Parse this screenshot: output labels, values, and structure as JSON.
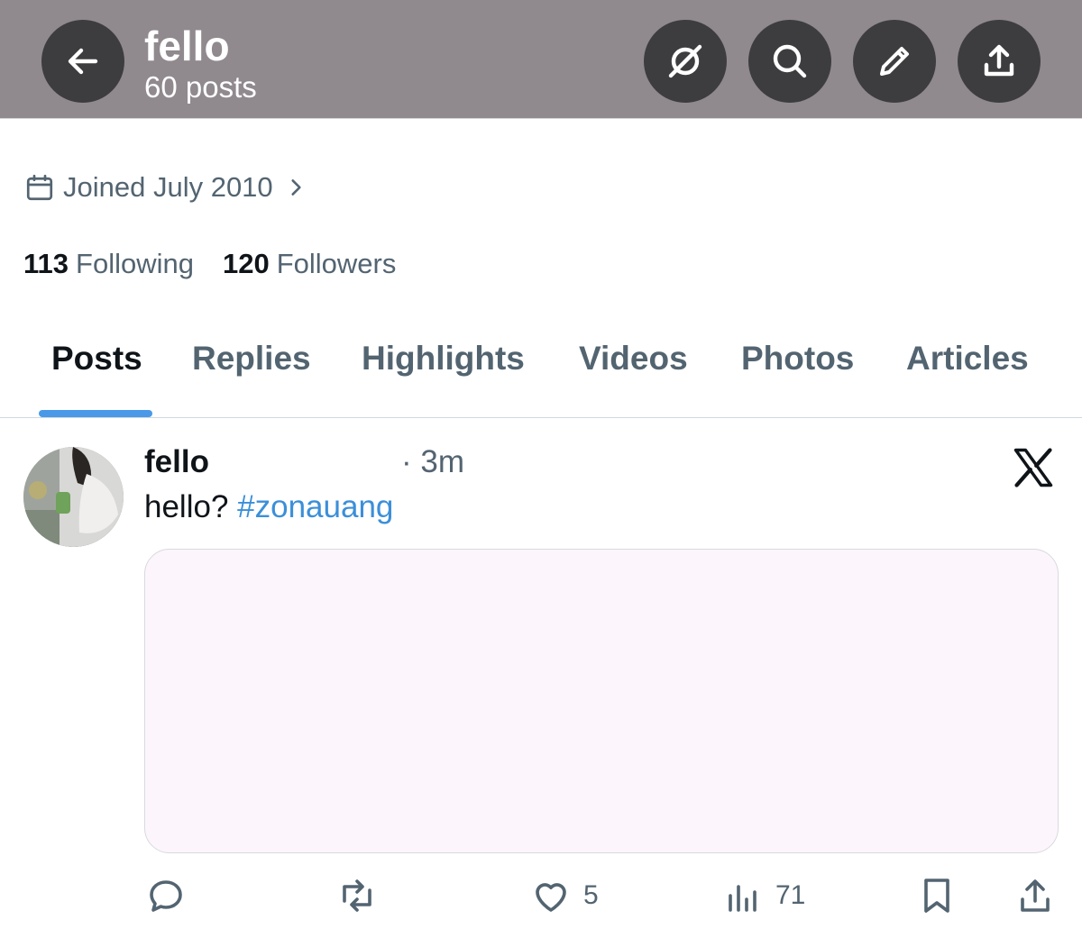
{
  "header": {
    "title": "fello",
    "post_count": "60 posts",
    "buttons": [
      "back-arrow-icon",
      "grok-icon",
      "search-icon",
      "pencil-icon",
      "share-icon"
    ]
  },
  "profile": {
    "joined": "Joined July 2010",
    "following_count": "113",
    "following_label": "Following",
    "followers_count": "120",
    "followers_label": "Followers"
  },
  "tabs": [
    {
      "label": "Posts",
      "active": true
    },
    {
      "label": "Replies",
      "active": false
    },
    {
      "label": "Highlights",
      "active": false
    },
    {
      "label": "Videos",
      "active": false
    },
    {
      "label": "Photos",
      "active": false
    },
    {
      "label": "Articles",
      "active": false
    }
  ],
  "post": {
    "author": "fello",
    "time": "· 3m",
    "text": "hello?",
    "hashtag": "#zonauang",
    "likes": "5",
    "views": "71"
  },
  "colors": {
    "header_bg": "#908a8f",
    "button_bg": "#3d3d3f",
    "accent": "#4a99e9",
    "link": "#3b8fd9",
    "muted_text": "#536471"
  }
}
